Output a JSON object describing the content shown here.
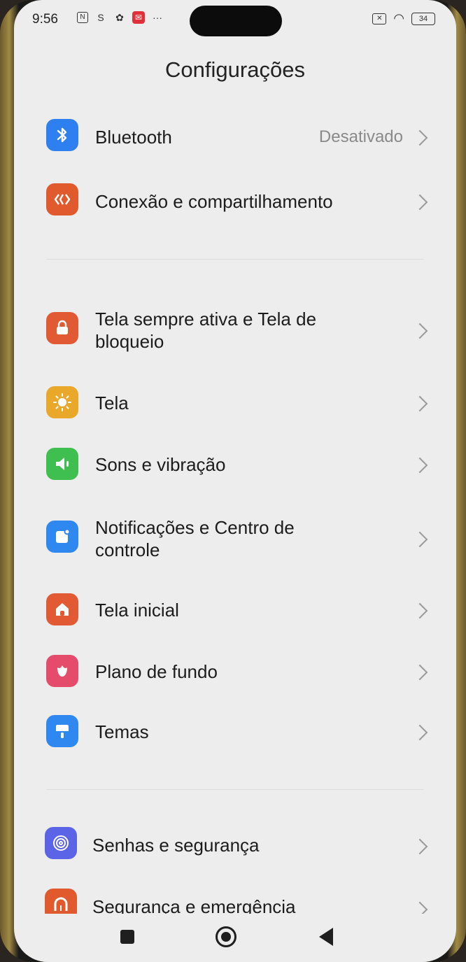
{
  "status_bar": {
    "time": "9:56",
    "battery": "34"
  },
  "header": {
    "title": "Configurações"
  },
  "items": [
    {
      "label": "Bluetooth",
      "value": "Desativado",
      "icon": "bluetooth-icon",
      "color": "#2e7ff0"
    },
    {
      "label": "Conexão e compartilhamento",
      "icon": "connection-icon",
      "color": "#e05a2e"
    },
    {
      "label": "Tela sempre ativa e Tela de bloqueio",
      "icon": "lock-icon",
      "color": "#e25a34"
    },
    {
      "label": "Tela",
      "icon": "sun-icon",
      "color": "#e9a82a"
    },
    {
      "label": "Sons e vibração",
      "icon": "speaker-icon",
      "color": "#3fbf4f"
    },
    {
      "label": "Notificações e Centro de controle",
      "icon": "notification-icon",
      "color": "#2e88f0"
    },
    {
      "label": "Tela inicial",
      "icon": "home-icon",
      "color": "#e25a34"
    },
    {
      "label": "Plano de fundo",
      "icon": "wallpaper-icon",
      "color": "#e54b6b"
    },
    {
      "label": "Temas",
      "icon": "theme-icon",
      "color": "#2e88f0"
    },
    {
      "label": "Senhas e segurança",
      "icon": "fingerprint-icon",
      "color": "#5b63e6"
    },
    {
      "label": "Segurança e emergência",
      "icon": "emergency-icon",
      "color": "#e05a2e"
    }
  ]
}
